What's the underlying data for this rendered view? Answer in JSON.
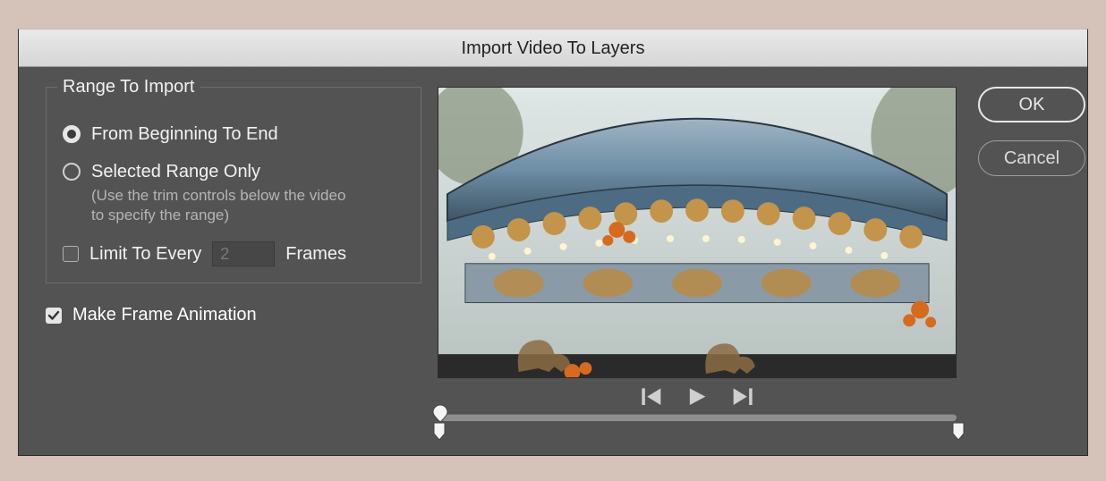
{
  "dialog": {
    "title": "Import Video To Layers"
  },
  "range_group": {
    "legend": "Range To Import",
    "from_beginning": {
      "label": "From Beginning To End",
      "selected": true
    },
    "selected_range": {
      "label": "Selected Range Only",
      "hint": "(Use the trim controls below the video to specify the range)",
      "selected": false
    },
    "limit": {
      "label_before": "Limit To Every",
      "value": "2",
      "label_after": "Frames",
      "checked": false
    }
  },
  "make_frame_animation": {
    "label": "Make Frame Animation",
    "checked": true
  },
  "transport": {
    "prev_frame": "previous-frame",
    "play": "play",
    "next_frame": "next-frame"
  },
  "trim": {
    "start_pct": 0,
    "end_pct": 100,
    "playhead_pct": 0
  },
  "buttons": {
    "ok": "OK",
    "cancel": "Cancel"
  },
  "preview": {
    "description": "carousel / merry-go-round video frame"
  }
}
